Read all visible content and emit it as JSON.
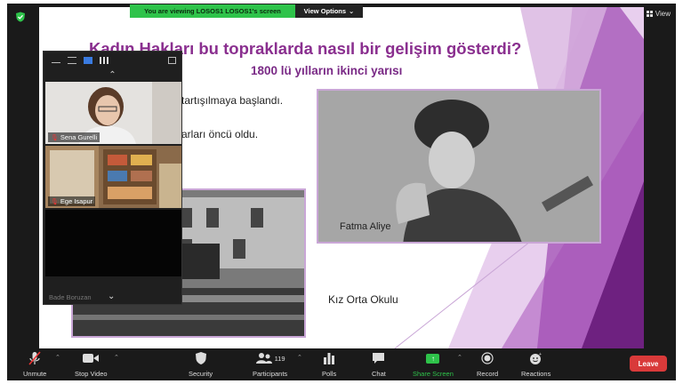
{
  "share_banner": {
    "viewing_text": "You are viewing LOSOS1 LOSOS1's screen",
    "view_options_label": "View Options"
  },
  "top_right": {
    "view_label": "View"
  },
  "slide": {
    "title": "Kadın Hakları bu topraklarda nasıl bir gelişim gösterdi?",
    "subtitle": "1800 lü yılların ikinci yarısı",
    "line1": "tartışılmaya başlandı.",
    "line2": "arları öncü oldu.",
    "caption_fatma": "Fatma Aliye",
    "caption_school": "Kız Orta Okulu"
  },
  "gallery": {
    "participants": [
      {
        "name": "Sena Gurelli",
        "muted": true
      },
      {
        "name": "Ege Isapur",
        "muted": true
      },
      {
        "name": "Bade Boruzan",
        "muted": true
      }
    ]
  },
  "toolbar": {
    "unmute": "Unmute",
    "stop_video": "Stop Video",
    "security": "Security",
    "participants": "Participants",
    "participants_count": "119",
    "polls": "Polls",
    "chat": "Chat",
    "share_screen": "Share Screen",
    "record": "Record",
    "reactions": "Reactions",
    "leave": "Leave"
  },
  "colors": {
    "accent_purple": "#8a2f8f",
    "share_green": "#2ec34a",
    "leave_red": "#d93a3a",
    "toolbar_dark": "#1a1a1a"
  }
}
